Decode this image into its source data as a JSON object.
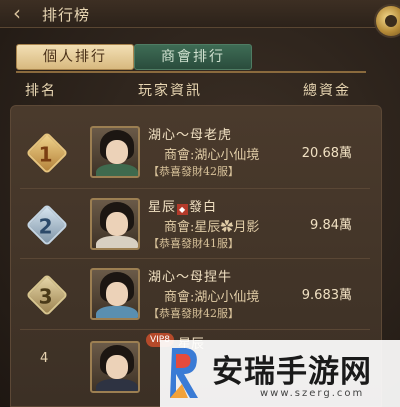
{
  "header": {
    "title": "排行榜"
  },
  "tabs": [
    {
      "label": "個人排行",
      "active": true
    },
    {
      "label": "商會排行",
      "active": false
    }
  ],
  "columns": {
    "rank": "排名",
    "player": "玩家資訊",
    "funds": "總資金"
  },
  "rows": [
    {
      "rank": "1",
      "name": "湖心～母老虎",
      "guild": "商會:湖心小仙境",
      "title": "【恭喜發財42服】",
      "funds": "20.68萬",
      "robe_color": "#3f6a4e"
    },
    {
      "rank": "2",
      "name_a": "星辰",
      "name_b": "發白",
      "guild_a": "商會:星辰",
      "guild_b": "月影",
      "title": "【恭喜發財41服】",
      "funds": "9.84萬",
      "robe_color": "#d8d0c2"
    },
    {
      "rank": "3",
      "name": "湖心～母捏牛",
      "guild": "商會:湖心小仙境",
      "title": "【恭喜發財42服】",
      "funds": "9.683萬",
      "robe_color": "#5a8fb0"
    },
    {
      "rank": "4",
      "vip": "VIP8",
      "name_partial": "星辰",
      "robe_color": "#2e3342"
    }
  ],
  "watermark": {
    "text": "安瑞手游网",
    "url": "www.szerg.com"
  },
  "colors": {
    "accent_gold": "#d8b97f",
    "tab_green": "#2a4c3c",
    "panel": "#4a3a2c"
  }
}
